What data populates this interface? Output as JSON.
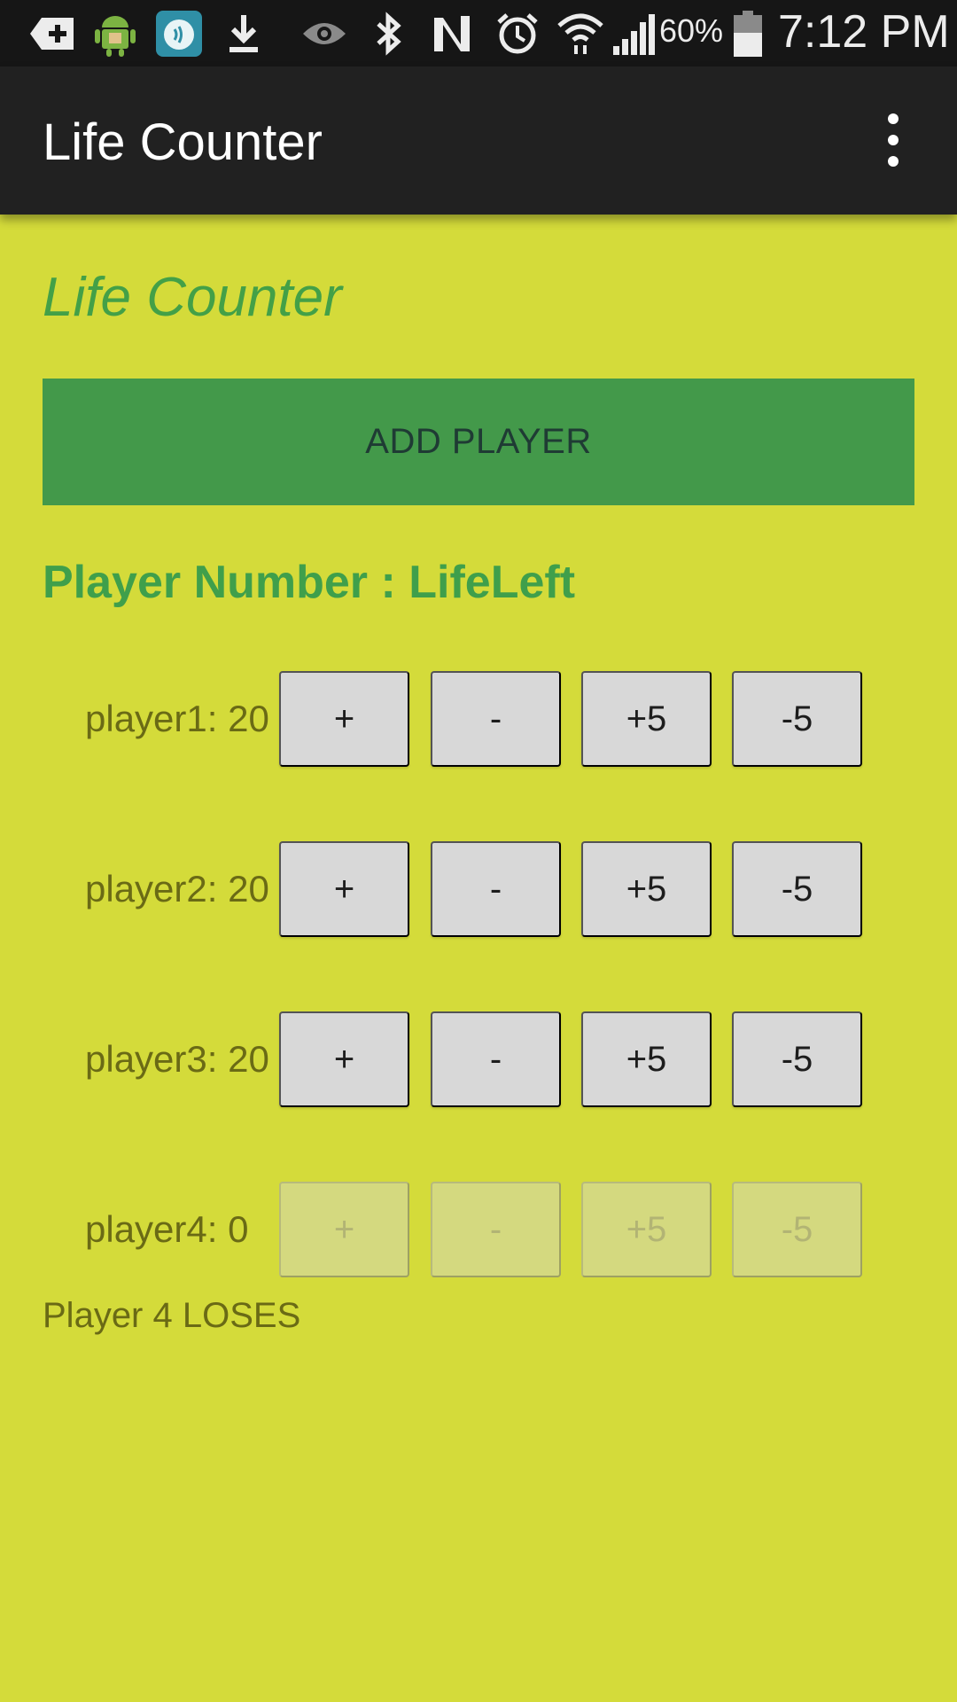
{
  "status_bar": {
    "icons": [
      "plus-box-icon",
      "android-icon",
      "alarm-app-icon",
      "download-icon",
      "eye-icon",
      "bluetooth-icon",
      "nfc-icon",
      "alarm-icon",
      "wifi-icon",
      "signal-icon",
      "battery-icon"
    ],
    "battery": "60%",
    "time": "7:12 PM"
  },
  "action_bar": {
    "title": "Life Counter",
    "menu_icon": "overflow-menu-icon"
  },
  "page": {
    "heading": "Life Counter",
    "add_player_label": "ADD PLAYER",
    "list_header": "Player Number : LifeLeft",
    "players": [
      {
        "label": "player1: 20",
        "buttons": [
          "+",
          "-",
          "+5",
          "-5"
        ],
        "enabled": true
      },
      {
        "label": "player2: 20",
        "buttons": [
          "+",
          "-",
          "+5",
          "-5"
        ],
        "enabled": true
      },
      {
        "label": "player3: 20",
        "buttons": [
          "+",
          "-",
          "+5",
          "-5"
        ],
        "enabled": true
      },
      {
        "label": "player4: 0",
        "buttons": [
          "+",
          "-",
          "+5",
          "-5"
        ],
        "enabled": false
      }
    ],
    "result": "Player 4 LOSES"
  },
  "colors": {
    "background": "#d4db3a",
    "accent_green": "#43a047",
    "button_gray": "#d8d8d8",
    "action_bar": "#212121"
  }
}
